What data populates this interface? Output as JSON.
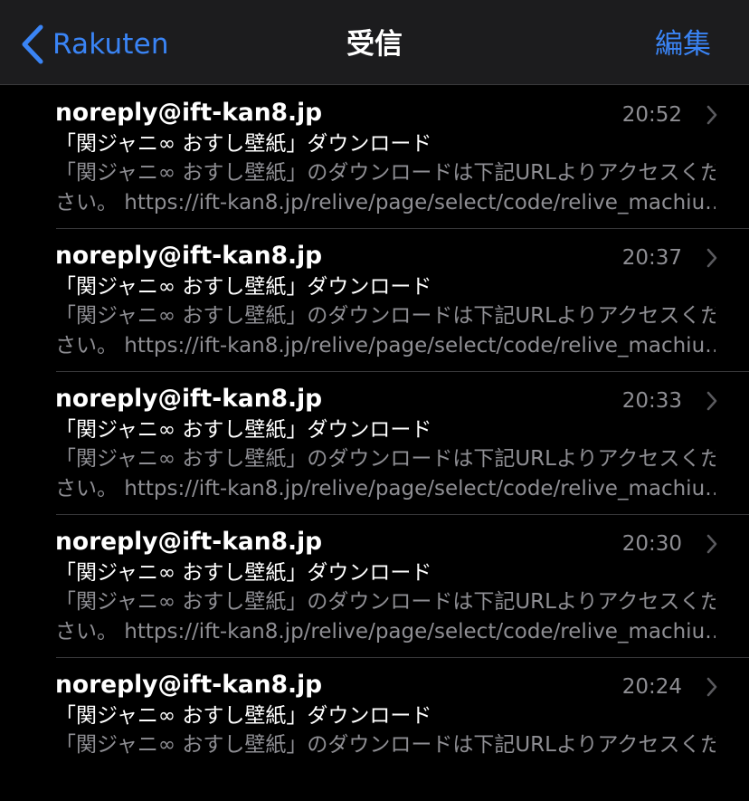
{
  "navbar": {
    "back_label": "Rakuten",
    "title": "受信",
    "edit_label": "編集"
  },
  "colors": {
    "accent": "#3a84f5",
    "background": "#000000",
    "navbar_bg": "#1c1c1e",
    "secondary_text": "#8e8e93"
  },
  "messages": [
    {
      "sender": "noreply@ift-kan8.jp",
      "time": "20:52",
      "subject": "「関ジャニ∞ おすし壁紙」ダウンロード",
      "preview_line1": "「関ジャニ∞ おすし壁紙」のダウンロードは下記URLよりアクセスくだ",
      "preview_line2": "さい。 https://ift-kan8.jp/relive/page/select/code/relive_machiu…"
    },
    {
      "sender": "noreply@ift-kan8.jp",
      "time": "20:37",
      "subject": "「関ジャニ∞ おすし壁紙」ダウンロード",
      "preview_line1": "「関ジャニ∞ おすし壁紙」のダウンロードは下記URLよりアクセスくだ",
      "preview_line2": "さい。 https://ift-kan8.jp/relive/page/select/code/relive_machiu…"
    },
    {
      "sender": "noreply@ift-kan8.jp",
      "time": "20:33",
      "subject": "「関ジャニ∞ おすし壁紙」ダウンロード",
      "preview_line1": "「関ジャニ∞ おすし壁紙」のダウンロードは下記URLよりアクセスくだ",
      "preview_line2": "さい。 https://ift-kan8.jp/relive/page/select/code/relive_machiu…"
    },
    {
      "sender": "noreply@ift-kan8.jp",
      "time": "20:30",
      "subject": "「関ジャニ∞ おすし壁紙」ダウンロード",
      "preview_line1": "「関ジャニ∞ おすし壁紙」のダウンロードは下記URLよりアクセスくだ",
      "preview_line2": "さい。 https://ift-kan8.jp/relive/page/select/code/relive_machiu…"
    },
    {
      "sender": "noreply@ift-kan8.jp",
      "time": "20:24",
      "subject": "「関ジャニ∞ おすし壁紙」ダウンロード",
      "preview_line1": "「関ジャニ∞ おすし壁紙」のダウンロードは下記URLよりアクセスくだ",
      "preview_line2": ""
    }
  ]
}
